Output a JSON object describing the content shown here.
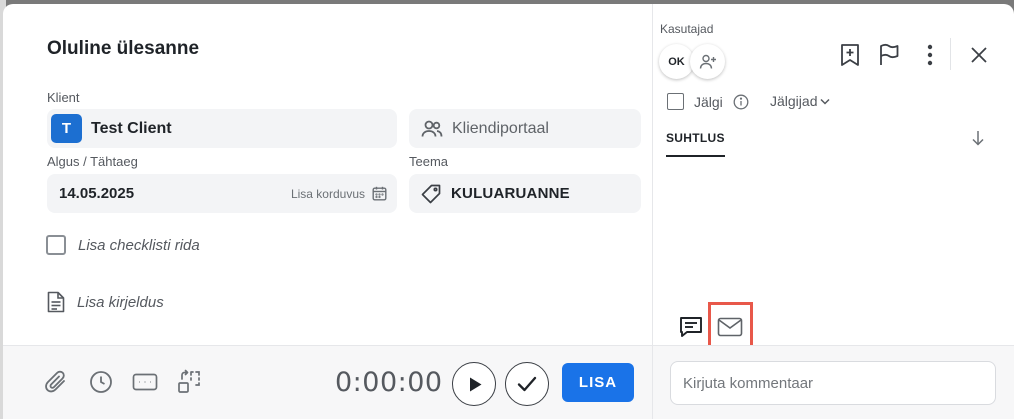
{
  "task": {
    "title": "Oluline ülesanne",
    "client_label": "Klient",
    "client_initial": "T",
    "client_name": "Test Client",
    "portal_label": "Kliendiportaal",
    "date_label": "Algus / Tähtaeg",
    "date_value": "14.05.2025",
    "repeat_label": "Lisa korduvus",
    "theme_label": "Teema",
    "theme_value": "KULUARUANNE",
    "checklist_placeholder": "Lisa checklisti rida",
    "description_placeholder": "Lisa kirjeldus"
  },
  "bottom": {
    "timer": "0:00:00",
    "add_button": "LISA",
    "comment_placeholder": "Kirjuta kommentaar"
  },
  "side": {
    "users_label": "Kasutajad",
    "user_initials": "OK",
    "follow_label": "Jälgi",
    "followers_label": "Jälgijad",
    "tab_communication": "SUHTLUS"
  },
  "colors": {
    "accent": "#1a73e8",
    "client_badge": "#1c6fd1",
    "highlight": "#e8584a"
  }
}
